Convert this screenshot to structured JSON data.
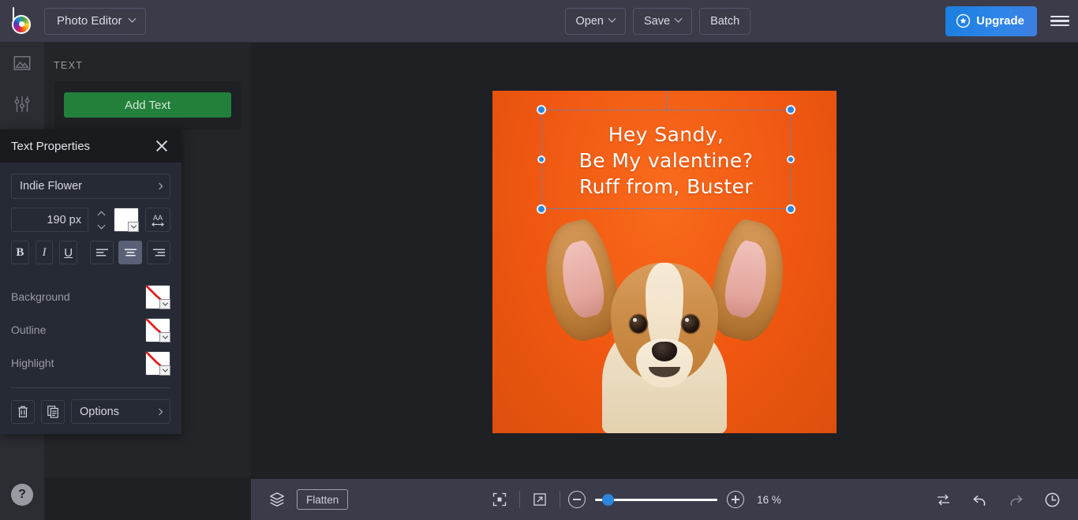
{
  "header": {
    "logo_icon": "befunky-color-wheel-logo",
    "app_menu_label": "Photo Editor",
    "buttons": [
      {
        "label": "Open",
        "icon": "chevron-down-icon",
        "name": "open-button"
      },
      {
        "label": "Save",
        "icon": "chevron-down-icon",
        "name": "save-button"
      },
      {
        "label": "Batch",
        "icon": "",
        "name": "batch-button"
      }
    ],
    "upgrade_label": "Upgrade",
    "upgrade_icon": "star-badge-icon",
    "menu_icon": "hamburger-menu-icon",
    "accent_blue": "#2a86df",
    "header_bg": "#3b3b4a"
  },
  "rail": {
    "items": [
      {
        "name": "sidebar-item-image",
        "icon": "image-mountain-icon"
      },
      {
        "name": "sidebar-item-adjust",
        "icon": "sliders-icon"
      }
    ],
    "help_label": "?"
  },
  "text_panel": {
    "title": "TEXT",
    "add_text_label": "Add Text",
    "add_text_color": "#22803a"
  },
  "text_properties": {
    "title": "Text Properties",
    "close_icon": "close-icon",
    "font_family": "Indie Flower",
    "font_size_value": "190",
    "font_size_unit": "px",
    "color_swatch": "#ffffff",
    "spacing_icon": "letter-spacing-AA-icon",
    "spacing_label": "AA",
    "style_buttons": [
      {
        "label": "B",
        "name": "bold-button",
        "active": false
      },
      {
        "label": "I",
        "name": "italic-button",
        "active": false
      },
      {
        "label": "U",
        "name": "underline-button",
        "active": false
      }
    ],
    "align_buttons": [
      {
        "name": "align-left-button",
        "icon": "align-left-icon",
        "active": false
      },
      {
        "name": "align-center-button",
        "icon": "align-center-icon",
        "active": true
      },
      {
        "name": "align-right-button",
        "icon": "align-right-icon",
        "active": false
      }
    ],
    "rows": [
      {
        "label": "Background",
        "name": "background-color-row",
        "value": "none"
      },
      {
        "label": "Outline",
        "name": "outline-color-row",
        "value": "none"
      },
      {
        "label": "Highlight",
        "name": "highlight-color-row",
        "value": "none"
      }
    ],
    "delete_icon": "trash-icon",
    "duplicate_icon": "duplicate-icon",
    "options_label": "Options"
  },
  "canvas": {
    "artboard_bg": "#ef5a12",
    "text_lines": [
      "Hey Sandy,",
      "Be My valentine?",
      "Ruff from, Buster"
    ],
    "subject": "corgi-puppy-photo",
    "selection_active": true
  },
  "bottom_bar": {
    "layers_icon": "layers-icon",
    "flatten_label": "Flatten",
    "fit_icon": "fit-to-screen-icon",
    "expand_icon": "open-in-new-icon",
    "zoom_out_icon": "minus-circle-icon",
    "zoom_in_icon": "plus-circle-icon",
    "zoom_level": "16 %",
    "zoom_slider_percent": 10,
    "compare_icon": "compare-swap-icon",
    "undo_icon": "undo-icon",
    "redo_icon": "redo-icon",
    "history_icon": "history-clock-icon"
  }
}
